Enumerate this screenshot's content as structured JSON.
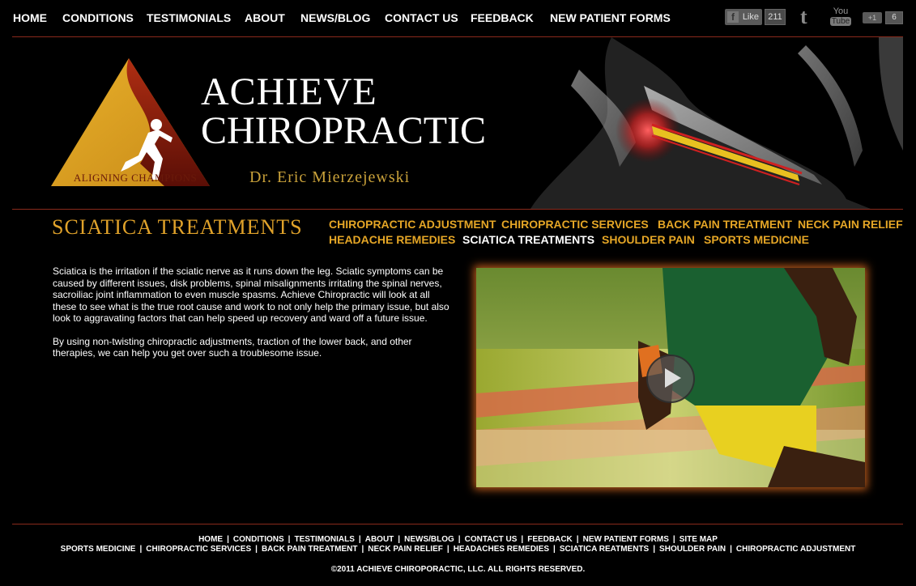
{
  "top_nav": [
    "HOME",
    "CONDITIONS",
    "TESTIMONIALS",
    "ABOUT",
    "NEWS/BLOG",
    "CONTACT US",
    "FEEDBACK",
    "NEW PATIENT FORMS"
  ],
  "social": {
    "facebook_like": "Like",
    "facebook_count": "211",
    "twitter_icon": "twitter-icon",
    "youtube_text_1": "You",
    "youtube_text_2": "Tube",
    "gplus_label": "+1",
    "gplus_count": "6"
  },
  "logo": {
    "tagline": "ALIGNING CHAMPIONS"
  },
  "brand": {
    "line1": "ACHIEVE",
    "line2": "CHIROPRACTIC",
    "doctor": "Dr. Eric Mierzejewski"
  },
  "page_title": "SCIATICA TREATMENTS",
  "sub_nav": {
    "row1": [
      "CHIROPRACTIC ADJUSTMENT",
      "CHIROPRACTIC SERVICES",
      "BACK PAIN TREATMENT",
      "NECK PAIN RELIEF"
    ],
    "row2": [
      "HEADACHE REMEDIES",
      "SCIATICA TREATMENTS",
      "SHOULDER PAIN",
      "SPORTS MEDICINE"
    ],
    "active": "SCIATICA TREATMENTS"
  },
  "content": {
    "p1": "Sciatica is the irritation if the sciatic nerve as it runs down the leg. Sciatic symptoms can be caused by different issues, disk problems, spinal misalignments irritating the spinal nerves, sacroiliac joint inflammation to even muscle spasms. Achieve Chiropractic will look at all these to see what is the true root cause and work to not only help the primary issue, but also look to aggravating factors that can help speed up recovery and ward off a future issue.",
    "p2": "By using non-twisting chiropractic adjustments, traction of the lower back,  and other therapies, we can help you get over such a troublesome issue."
  },
  "footer": {
    "row1": [
      "HOME",
      "CONDITIONS",
      "TESTIMONIALS",
      "ABOUT",
      "NEWS/BLOG",
      "CONTACT US",
      "FEEDBACK",
      "NEW PATIENT FORMS",
      "SITE MAP"
    ],
    "row2": [
      "SPORTS MEDICINE",
      "CHIROPRACTIC SERVICES",
      "BACK PAIN TREATMENT",
      "NECK PAIN RELIEF",
      "HEADACHES REMEDIES",
      "SCIATICA REATMENTS",
      "SHOULDER PAIN",
      "CHIROPRACTIC ADJUSTMENT"
    ],
    "copyright": "©2011 ACHIEVE CHIROPORACTIC, LLC. ALL RIGHTS RESERVED.",
    "separator": "|"
  },
  "colors": {
    "accent": "#e5a626",
    "rule": "#8a2a1c",
    "video_glow": "#b4571a"
  }
}
